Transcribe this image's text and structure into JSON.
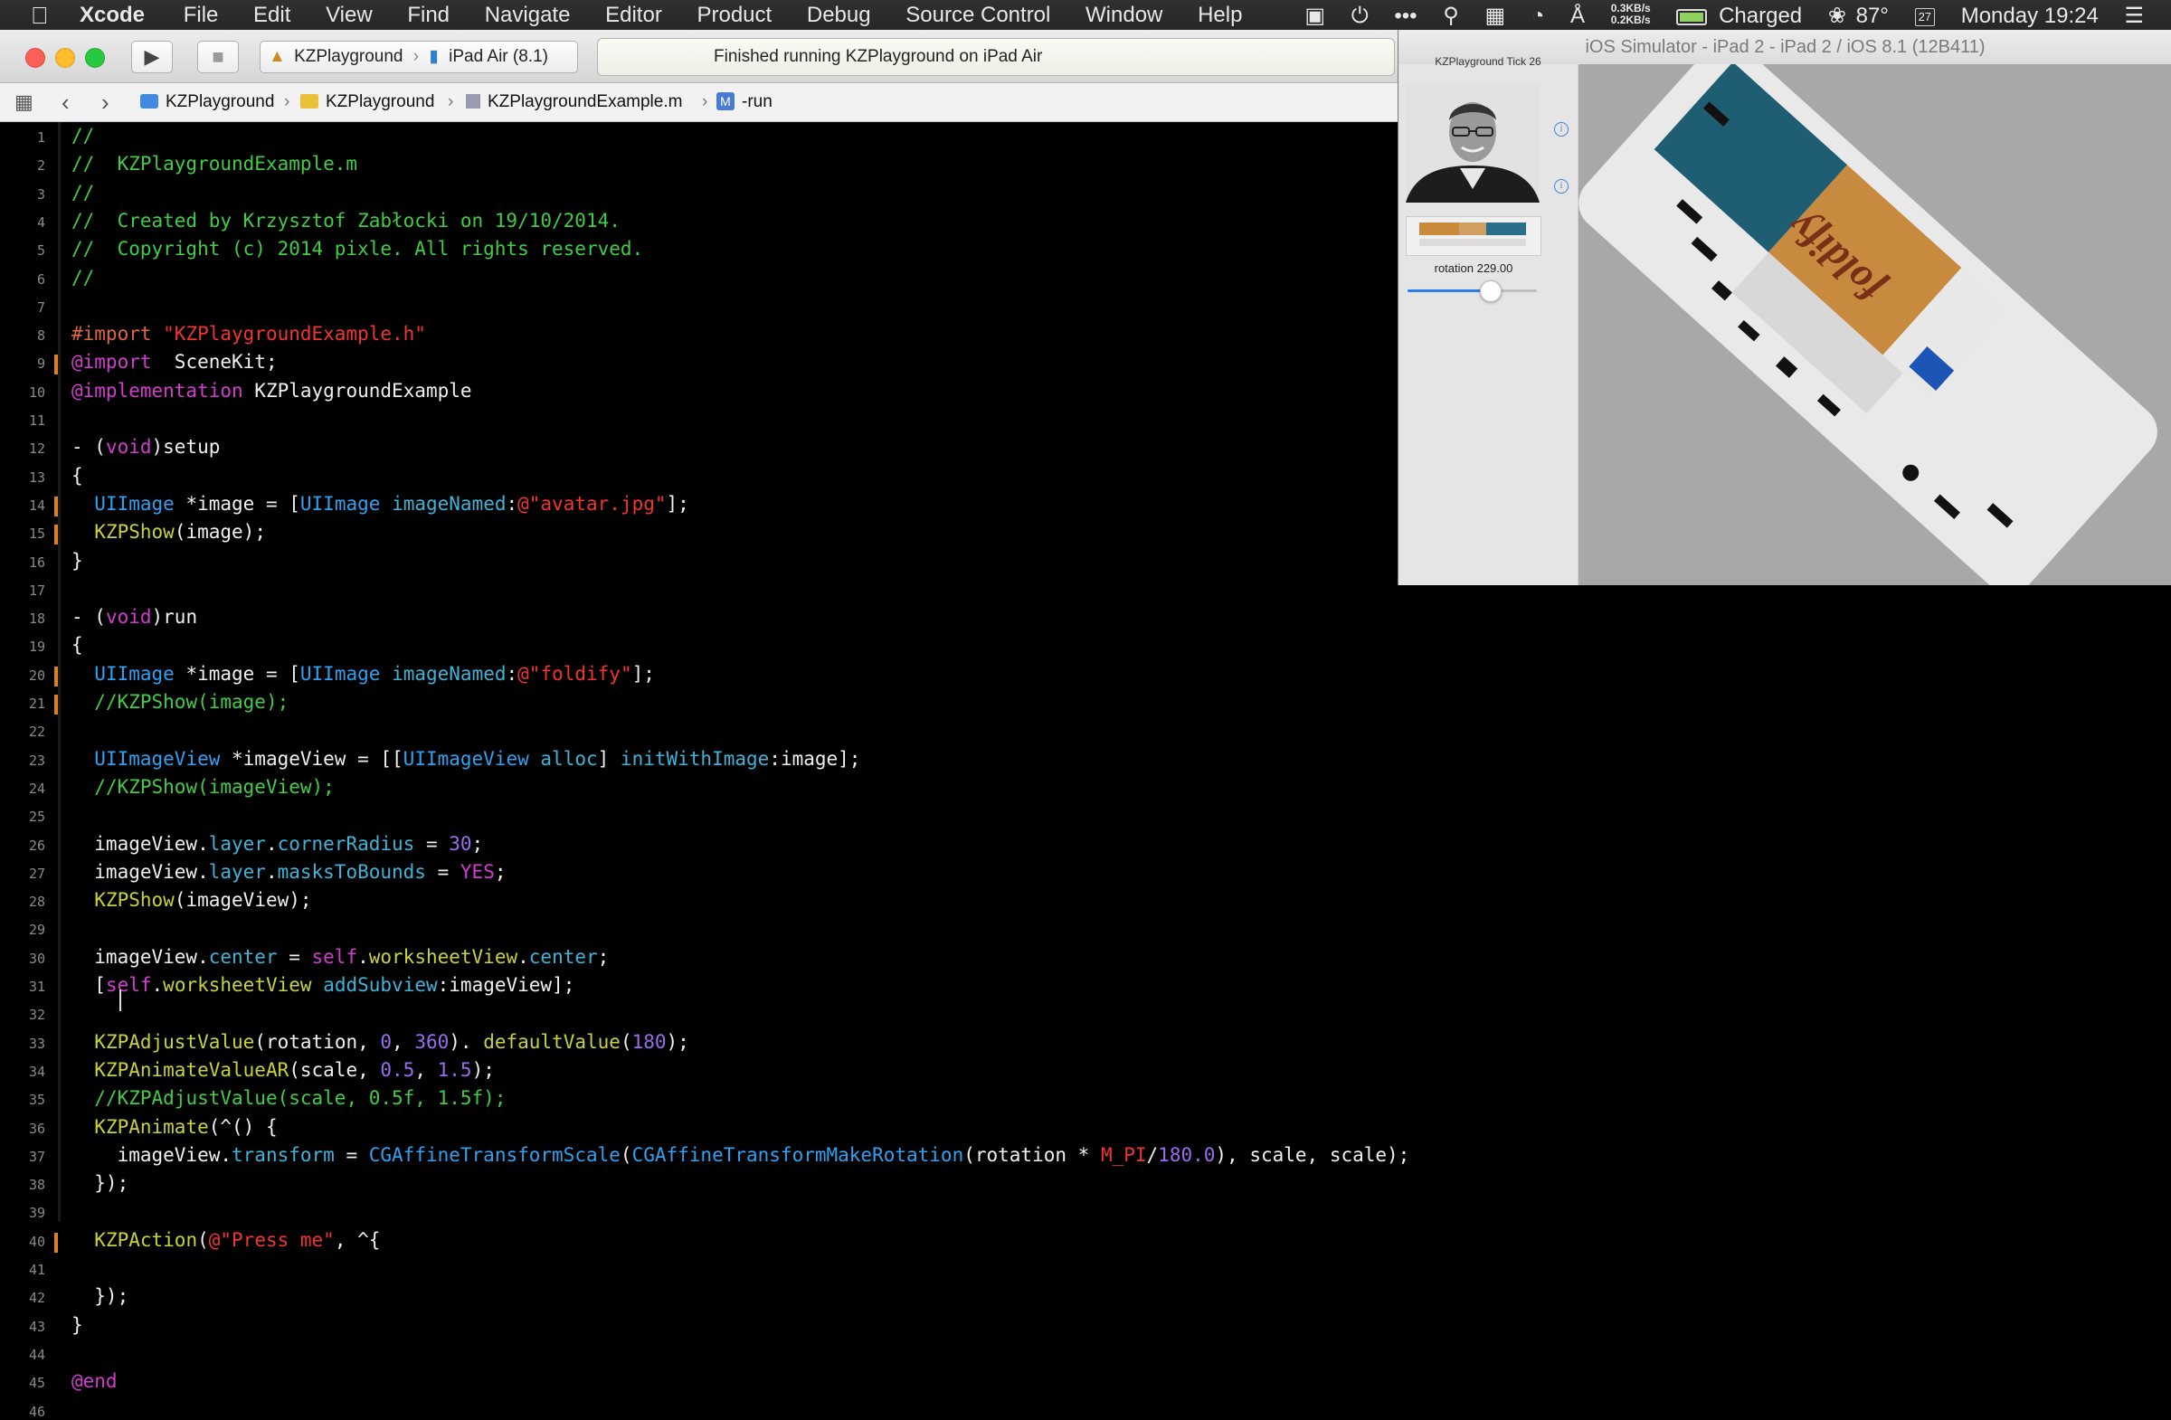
{
  "menubar": {
    "app": "Xcode",
    "items": [
      "File",
      "Edit",
      "View",
      "Find",
      "Navigate",
      "Editor",
      "Product",
      "Debug",
      "Source Control",
      "Window",
      "Help"
    ],
    "net_up": "0.3KB/s",
    "net_down": "0.2KB/s",
    "battery": "Charged",
    "temperature": "87°",
    "calendar_day": "27",
    "clock": "Monday 19:24"
  },
  "toolbar": {
    "scheme": "KZPlayground",
    "device": "iPad Air (8.1)",
    "activity": "Finished running KZPlayground on iPad Air"
  },
  "jumpbar": {
    "crumbs": [
      "KZPlayground",
      "KZPlayground",
      "KZPlaygroundExample.m",
      "-run"
    ],
    "method_badge": "M"
  },
  "editor": {
    "line_numbers": [
      "1",
      "2",
      "3",
      "4",
      "5",
      "6",
      "7",
      "8",
      "9",
      "10",
      "11",
      "12",
      "13",
      "14",
      "15",
      "16",
      "17",
      "18",
      "19",
      "20",
      "21",
      "22",
      "23",
      "24",
      "25",
      "26",
      "27",
      "28",
      "29",
      "30",
      "31",
      "32",
      "33",
      "34",
      "35",
      "36",
      "37",
      "38",
      "39",
      "40",
      "41",
      "42",
      "43",
      "44",
      "45",
      "46"
    ],
    "lines": [
      [
        [
          "cm",
          "//"
        ]
      ],
      [
        [
          "cm",
          "//  KZPlaygroundExample.m"
        ]
      ],
      [
        [
          "cm",
          "//"
        ]
      ],
      [
        [
          "cm",
          "//  Created by Krzysztof Zabłocki on 19/10/2014."
        ]
      ],
      [
        [
          "cm",
          "//  Copyright (c) 2014 pixle. All rights reserved."
        ]
      ],
      [
        [
          "cm",
          "//"
        ]
      ],
      [],
      [
        [
          "pp",
          "#import "
        ],
        [
          "st",
          "\"KZPlaygroundExample.h\""
        ]
      ],
      [
        [
          "kw",
          "@import"
        ],
        [
          "",
          "  SceneKit;"
        ]
      ],
      [
        [
          "kw",
          "@implementation"
        ],
        [
          "",
          " KZPlaygroundExample"
        ]
      ],
      [],
      [
        [
          "",
          "- ("
        ],
        [
          "kw",
          "void"
        ],
        [
          "",
          ")setup"
        ]
      ],
      [
        [
          "",
          "{"
        ]
      ],
      [
        [
          "",
          "  "
        ],
        [
          "ty",
          "UIImage"
        ],
        [
          "",
          " *image = ["
        ],
        [
          "ty",
          "UIImage"
        ],
        [
          "",
          " "
        ],
        [
          "pr",
          "imageNamed"
        ],
        [
          "",
          ":"
        ],
        [
          "st",
          "@\"avatar.jpg\""
        ],
        [
          "",
          "];"
        ]
      ],
      [
        [
          "",
          "  "
        ],
        [
          "fn",
          "KZPShow"
        ],
        [
          "",
          "(image);"
        ]
      ],
      [
        [
          "",
          "}"
        ]
      ],
      [],
      [
        [
          "",
          "- ("
        ],
        [
          "kw",
          "void"
        ],
        [
          "",
          ")run"
        ]
      ],
      [
        [
          "",
          "{"
        ]
      ],
      [
        [
          "",
          "  "
        ],
        [
          "ty",
          "UIImage"
        ],
        [
          "",
          " *image = ["
        ],
        [
          "ty",
          "UIImage"
        ],
        [
          "",
          " "
        ],
        [
          "pr",
          "imageNamed"
        ],
        [
          "",
          ":"
        ],
        [
          "st",
          "@\"foldify\""
        ],
        [
          "",
          "];"
        ]
      ],
      [
        [
          "",
          "  "
        ],
        [
          "cm",
          "//KZPShow(image);"
        ]
      ],
      [],
      [
        [
          "",
          "  "
        ],
        [
          "ty",
          "UIImageView"
        ],
        [
          "",
          " *imageView = [["
        ],
        [
          "ty",
          "UIImageView"
        ],
        [
          "",
          " "
        ],
        [
          "pr",
          "alloc"
        ],
        [
          "",
          "] "
        ],
        [
          "pr",
          "initWithImage"
        ],
        [
          "",
          ":image];"
        ]
      ],
      [
        [
          "",
          "  "
        ],
        [
          "cm",
          "//KZPShow(imageView);"
        ]
      ],
      [],
      [
        [
          "",
          "  imageView."
        ],
        [
          "pr",
          "layer"
        ],
        [
          "",
          "."
        ],
        [
          "pr",
          "cornerRadius"
        ],
        [
          "",
          " = "
        ],
        [
          "nm",
          "30"
        ],
        [
          "",
          ";"
        ]
      ],
      [
        [
          "",
          "  imageView."
        ],
        [
          "pr",
          "layer"
        ],
        [
          "",
          "."
        ],
        [
          "pr",
          "masksToBounds"
        ],
        [
          "",
          " = "
        ],
        [
          "kw",
          "YES"
        ],
        [
          "",
          ";"
        ]
      ],
      [
        [
          "",
          "  "
        ],
        [
          "fn",
          "KZPShow"
        ],
        [
          "",
          "(imageView);"
        ]
      ],
      [],
      [
        [
          "",
          "  imageView."
        ],
        [
          "pr",
          "center"
        ],
        [
          "",
          " = "
        ],
        [
          "kw",
          "self"
        ],
        [
          "",
          "."
        ],
        [
          "fn",
          "worksheetView"
        ],
        [
          "",
          "."
        ],
        [
          "pr",
          "center"
        ],
        [
          "",
          ";"
        ]
      ],
      [
        [
          "",
          "  ["
        ],
        [
          "kw",
          "self"
        ],
        [
          "",
          "."
        ],
        [
          "fn",
          "worksheetView"
        ],
        [
          "",
          " "
        ],
        [
          "pr",
          "addSubview"
        ],
        [
          "",
          ":imageView];"
        ]
      ],
      [],
      [
        [
          "",
          "  "
        ],
        [
          "fn",
          "KZPAdjustValue"
        ],
        [
          "",
          "(rotation, "
        ],
        [
          "nm",
          "0"
        ],
        [
          "",
          ", "
        ],
        [
          "nm",
          "360"
        ],
        [
          "",
          "). "
        ],
        [
          "fn",
          "defaultValue"
        ],
        [
          "",
          "("
        ],
        [
          "nm",
          "180"
        ],
        [
          "",
          ");"
        ]
      ],
      [
        [
          "",
          "  "
        ],
        [
          "fn",
          "KZPAnimateValueAR"
        ],
        [
          "",
          "(scale, "
        ],
        [
          "nm",
          "0.5"
        ],
        [
          "",
          ", "
        ],
        [
          "nm",
          "1.5"
        ],
        [
          "",
          ");"
        ]
      ],
      [
        [
          "",
          "  "
        ],
        [
          "cm",
          "//KZPAdjustValue(scale, 0.5f, 1.5f);"
        ]
      ],
      [
        [
          "",
          "  "
        ],
        [
          "fn",
          "KZPAnimate"
        ],
        [
          "",
          "(^() {"
        ]
      ],
      [
        [
          "",
          "    imageView."
        ],
        [
          "pr",
          "transform"
        ],
        [
          "",
          " = "
        ],
        [
          "ty",
          "CGAffineTransformScale"
        ],
        [
          "",
          "("
        ],
        [
          "ty",
          "CGAffineTransformMakeRotation"
        ],
        [
          "",
          "(rotation * "
        ],
        [
          "st",
          "M_PI"
        ],
        [
          "",
          "/"
        ],
        [
          "nm",
          "180.0"
        ],
        [
          "",
          "), scale, scale);"
        ]
      ],
      [
        [
          "",
          "  });"
        ]
      ],
      [],
      [
        [
          "",
          "  "
        ],
        [
          "fn",
          "KZPAction"
        ],
        [
          "",
          "("
        ],
        [
          "st",
          "@\"Press me\""
        ],
        [
          "",
          ", ^{"
        ]
      ],
      [],
      [
        [
          "",
          "  });"
        ]
      ],
      [
        [
          "",
          "}"
        ]
      ],
      [],
      [
        [
          "kw",
          "@end"
        ]
      ],
      []
    ]
  },
  "simulator": {
    "title": "iOS Simulator - iPad 2 - iPad 2 / iOS 8.1 (12B411)",
    "tick_label": "KZPlayground Tick 26",
    "rotation_label": "rotation 229.00",
    "rotation_fraction": 0.636,
    "info_glyph": "i",
    "image_text": "foldify"
  },
  "colors": {
    "comment": "#41cc45",
    "string": "#f2352e",
    "keyword": "#d43bd0",
    "type": "#2fa1f2",
    "accent": "#2a7cf0"
  }
}
